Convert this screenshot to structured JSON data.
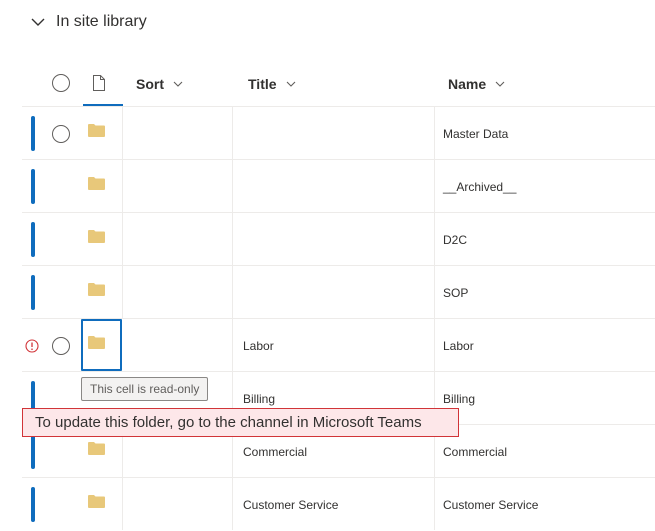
{
  "section": {
    "title": "In site library",
    "icon": "chevron-down-icon"
  },
  "columns": {
    "select_icon": "circle-select-icon",
    "file_type_icon": "document-icon",
    "sort": "Sort",
    "title": "Title",
    "name": "Name"
  },
  "rows": [
    {
      "title": "",
      "name": "Master Data",
      "icon": "folder-icon"
    },
    {
      "title": "",
      "name": "__Archived__",
      "icon": "folder-icon"
    },
    {
      "title": "",
      "name": "D2C",
      "icon": "folder-icon"
    },
    {
      "title": "",
      "name": "SOP",
      "icon": "folder-icon"
    },
    {
      "title": "Labor",
      "name": "Labor",
      "icon": "folder-icon",
      "status_icon": "error-circle-icon"
    },
    {
      "title": "Billing",
      "name": "Billing",
      "icon": "folder-icon"
    },
    {
      "title": "Commercial",
      "name": "Commercial",
      "icon": "folder-icon"
    },
    {
      "title": "Customer Service",
      "name": "Customer Service",
      "icon": "folder-icon"
    }
  ],
  "tooltip": {
    "text": "This cell is read-only"
  },
  "error_banner": {
    "text": "To update this folder, go to the channel in Microsoft Teams"
  },
  "colors": {
    "accent": "#0f6cbd",
    "folder": "#e8c87a",
    "error_border": "#d13438",
    "error_bg": "#fde7e9"
  }
}
